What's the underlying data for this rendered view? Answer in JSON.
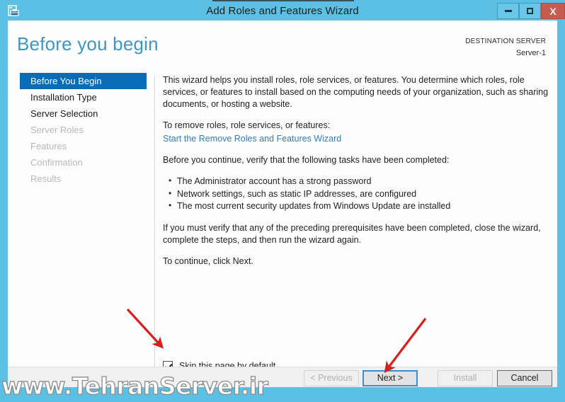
{
  "window": {
    "title": "Add Roles and Features Wizard",
    "app_icon": "server-toolbox-icon",
    "controls": {
      "minimize": "–",
      "maximize": "□",
      "close": "X"
    },
    "chrome_color": "#5cc0e4",
    "close_color": "#c75b4f"
  },
  "header": {
    "page_title": "Before you begin",
    "destination_label": "DESTINATION SERVER",
    "destination_value": "Server-1",
    "title_color": "#3f96c4"
  },
  "sidebar": {
    "selected_color": "#0a6cb4",
    "items": [
      {
        "label": "Before You Begin",
        "state": "selected"
      },
      {
        "label": "Installation Type",
        "state": "enabled"
      },
      {
        "label": "Server Selection",
        "state": "enabled"
      },
      {
        "label": "Server Roles",
        "state": "disabled"
      },
      {
        "label": "Features",
        "state": "disabled"
      },
      {
        "label": "Confirmation",
        "state": "disabled"
      },
      {
        "label": "Results",
        "state": "disabled"
      }
    ]
  },
  "content": {
    "intro": "This wizard helps you install roles, role services, or features. You determine which roles, role services, or features to install based on the computing needs of your organization, such as sharing documents, or hosting a website.",
    "remove_prompt": "To remove roles, role services, or features:",
    "remove_link": "Start the Remove Roles and Features Wizard",
    "verify_prompt": "Before you continue, verify that the following tasks have been completed:",
    "tasks": [
      "The Administrator account has a strong password",
      "Network settings, such as static IP addresses, are configured",
      "The most current security updates from Windows Update are installed"
    ],
    "prereq_note": "If you must verify that any of the preceding prerequisites have been completed, close the wizard, complete the steps, and then run the wizard again.",
    "continue_note": "To continue, click Next.",
    "link_color": "#2e7fb4"
  },
  "skip_option": {
    "label": "Skip this page by default",
    "checked": "true"
  },
  "footer": {
    "buttons": [
      {
        "label": "< Previous",
        "state": "disabled"
      },
      {
        "label": "Next >",
        "state": "focused"
      },
      {
        "label": "Install",
        "state": "disabled"
      },
      {
        "label": "Cancel",
        "state": "enabled"
      }
    ]
  },
  "annotations": {
    "arrow_color": "#d81f1f",
    "arrow_checkbox_target": "skip-this-page-checkbox",
    "arrow_next_target": "next-button"
  },
  "watermark": {
    "text": "www.TehranServer.ir"
  }
}
